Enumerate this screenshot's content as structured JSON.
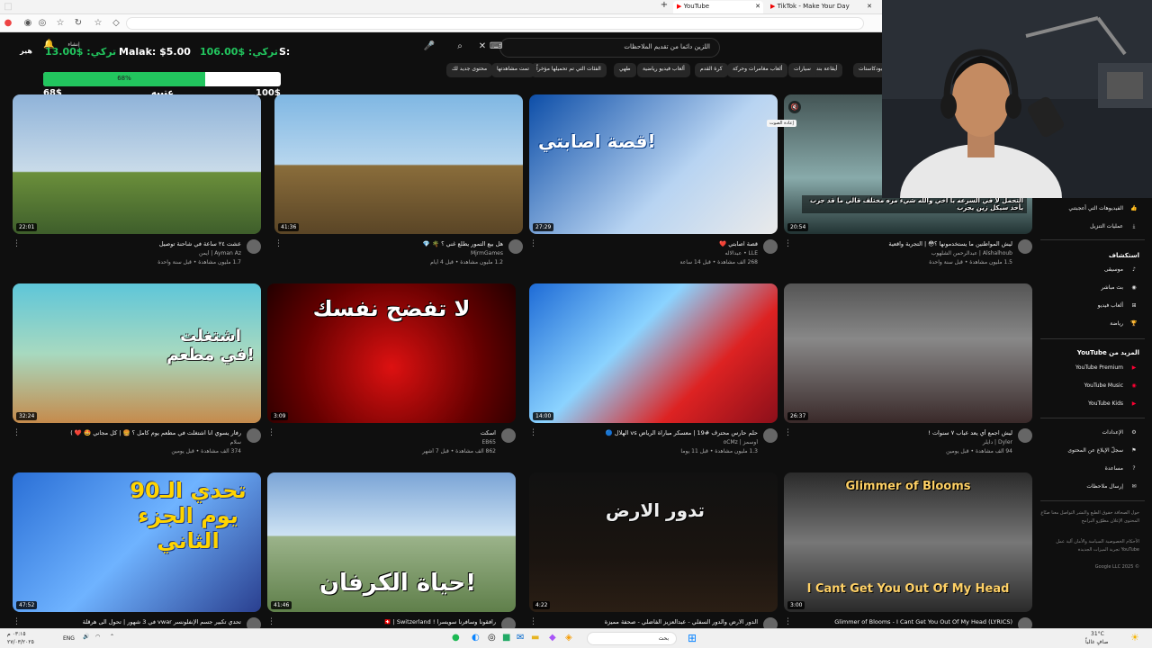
{
  "browser": {
    "tabs": [
      {
        "label": "YouTube",
        "active": true
      },
      {
        "label": "TikTok - Make Your Day",
        "active": false
      }
    ],
    "new_tab": "+"
  },
  "youtube": {
    "search_value": "اللزين دائما من تقديم الملاحظات",
    "create_label": "إنشاء",
    "logo_text": "هير"
  },
  "chips": [
    "بودكاستات",
    "أيقاعة بندية",
    "سيارات",
    "ألعاب مغامرات وحركة",
    "كرة القدم",
    "ألعاب فيديو رياضية",
    "طهي",
    "الفئات التي تم تحميلها مؤخراً",
    "تمت مشاهدتها",
    "محتوى جديد لك"
  ],
  "stream_overlay": {
    "t1": "13.00$ :تركي",
    "malak": "Malak: $5.00",
    "t2": "106.00$ :تركي",
    "edge": "S:",
    "progress_text": "68%",
    "progress_value": 0.68,
    "left_value": "68$",
    "right_value": "100$",
    "caption": "عتيبه"
  },
  "videos": [
    {
      "title": "عشت ٢٤ ساعة في شاحنة توصيل",
      "channel": "Ayman Az | أيمن",
      "stats": "1.7 مليون مشاهدة • قبل سنة واحدة",
      "duration": "22:01",
      "overlay": ""
    },
    {
      "title": "هل بيع التمور يطلع غني ؟ 🌴 💎",
      "channel": "MjrmGames",
      "stats": "1.2 مليون مشاهدة • قبل 4 أيام",
      "duration": "41:36",
      "overlay": ""
    },
    {
      "title": "قصة اصابتي ❤️",
      "channel": "LLE • عبدالاله",
      "stats": "268 ألف مشاهدة • قبل 14 ساعة",
      "duration": "27:29",
      "overlay": "قصة اصابتي!"
    },
    {
      "title": "ليش المواطنين ما يستخدمونها ؟😳 | التجربة واقعية",
      "channel": "Alshalhoub | عبدالرحمن الشلهوب",
      "stats": "1.5 مليون مشاهدة • قبل سنة واحدة",
      "duration": "20:54",
      "overlay": "التحمل لا في السرعه يا اخي والله شيء مره مختلف قالي ما قد جرب يأخذ سيكل زين يجرب"
    },
    {
      "title": "رفار يسوي انا اشتغلت في مطعم يوم كامل ؟ 🍔 | كل مجاني 🤩 ❤️ )",
      "channel": "سلام",
      "stats": "374 ألف مشاهدة • قبل يومين",
      "duration": "32:24",
      "overlay": "اشتغلت في مطعم!"
    },
    {
      "title": "اسكت",
      "channel": "EB65",
      "stats": "862 ألف مشاهدة • قبل 7 أشهر",
      "duration": "3:09",
      "overlay": "لا تفضح نفسك"
    },
    {
      "title": "حلم حارس محترف #19 | معسكر مباراة الرياض vs الهلال 🔵",
      "channel": "أوسمز | oCMz",
      "stats": "1.3 مليون مشاهدة • قبل 11 يوماً",
      "duration": "14:00",
      "overlay": ""
    },
    {
      "title": "ليش اجمع أي يعد عباب ٧ سنوات !",
      "channel": "Dyler | دايلر",
      "stats": "94 ألف مشاهدة • قبل يومين",
      "duration": "26:37",
      "overlay": ""
    },
    {
      "title": "تحدي تكبير جسم الإنفلونسر vwar في 3 شهور | تحول الى هرقلة",
      "channel": "",
      "stats": "",
      "duration": "47:52",
      "overlay": "تحدي الـ90 يوم الجزء الثاني"
    },
    {
      "title": "رافقونا وسافرنا سويسرا ! 🇨🇭 | Switzerland",
      "channel": "",
      "stats": "",
      "duration": "41:46",
      "overlay": "حياة الكرفان!"
    },
    {
      "title": "الدور الارض والدور السفلي - عبدالعزيز الفاضلي - صحفة مميزة",
      "channel": "",
      "stats": "",
      "duration": "4:22",
      "overlay": "تدور الارض"
    },
    {
      "title": "Glimmer of Blooms - I Cant Get You Out Of My Head (LYRICS)",
      "channel": "",
      "stats": "",
      "duration": "3:00",
      "overlay": "Glimmer of Blooms",
      "overlay2": "I Cant Get You Out Of My Head"
    }
  ],
  "tooltip": "إعادة الصوت",
  "sidebar": {
    "items_top": [
      {
        "label": "الفيديوهات التي أعجبتني",
        "icon": "👍"
      },
      {
        "label": "عمليات التنزيل",
        "icon": "⤓"
      }
    ],
    "explore_title": "استكشاف",
    "explore": [
      {
        "label": "موسيقى",
        "icon": "♪"
      },
      {
        "label": "بث مباشر",
        "icon": "◉"
      },
      {
        "label": "ألعاب فيديو",
        "icon": "⊞"
      },
      {
        "label": "رياضة",
        "icon": "🏆"
      }
    ],
    "more_title": "المزيد من YouTube",
    "more": [
      {
        "label": "YouTube Premium",
        "color": "#ff0033"
      },
      {
        "label": "YouTube Music",
        "color": "#ff0033"
      },
      {
        "label": "YouTube Kids",
        "color": "#ff0033"
      }
    ],
    "settings": [
      {
        "label": "الإعدادات",
        "icon": "⚙"
      },
      {
        "label": "سجلّ الإبلاغ عن المحتوى",
        "icon": "⚑"
      },
      {
        "label": "مساعدة",
        "icon": "?"
      },
      {
        "label": "إرسال ملاحظات",
        "icon": "✉"
      }
    ],
    "footer1": "حول  الصحافة  حقوق الطبع والنشر  التواصل معنا  صنّاع المحتوى  الإعلان  مطوّرو البرامج",
    "footer2": "الأحكام  الخصوصية  السياسة والأمان  آلية عمل YouTube  تجربة الميزات الجديدة",
    "copyright": "© 2025 Google LLC"
  },
  "taskbar": {
    "search": "بحث",
    "lang": "ENG",
    "time": "٠٣:١٥ م",
    "date": "٢٧/٠٣/٢٠٢٥",
    "weather_temp": "31°C",
    "weather_text": "صافٍ غالباً"
  }
}
